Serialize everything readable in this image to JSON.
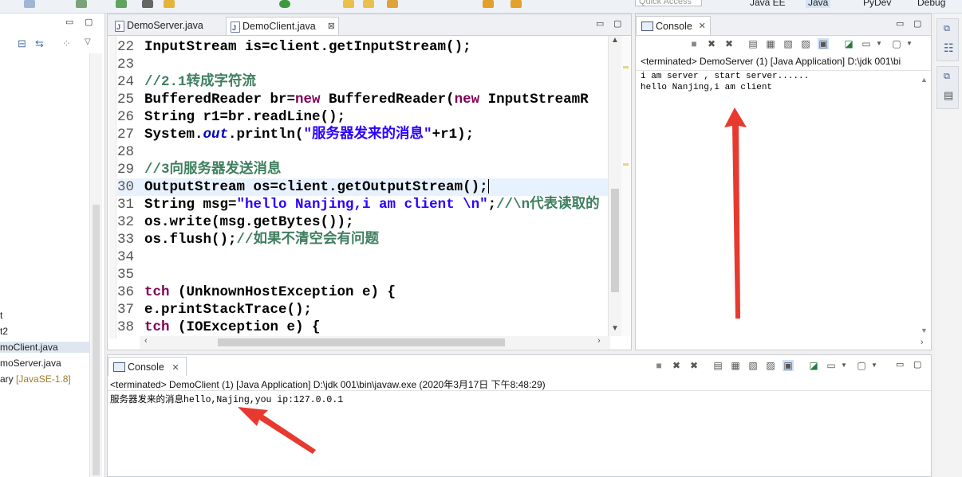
{
  "toolbar": {
    "quick_access_placeholder": "Quick Access",
    "perspectives": [
      "Java EE",
      "Java",
      "PyDev",
      "Debug"
    ]
  },
  "explorer": {
    "items": [
      {
        "label": "t",
        "selected": false
      },
      {
        "label": "t2",
        "selected": false
      },
      {
        "label": "moClient.java",
        "selected": true
      },
      {
        "label": "moServer.java",
        "selected": false
      },
      {
        "label": "ary",
        "lib": "[JavaSE-1.8]",
        "selected": false
      }
    ]
  },
  "editor": {
    "tabs": [
      {
        "label": "DemoServer.java",
        "active": false
      },
      {
        "label": "DemoClient.java",
        "active": true,
        "close": "⊠"
      }
    ],
    "lines": [
      {
        "n": "22",
        "segs": [
          {
            "t": "InputStream is=client.getInputStream();",
            "c": ""
          }
        ]
      },
      {
        "n": "23",
        "segs": []
      },
      {
        "n": "24",
        "segs": [
          {
            "t": "//2.1转成字符流",
            "c": "cm"
          }
        ]
      },
      {
        "n": "25",
        "segs": [
          {
            "t": "BufferedReader br=",
            "c": ""
          },
          {
            "t": "new",
            "c": "kw"
          },
          {
            "t": " BufferedReader(",
            "c": ""
          },
          {
            "t": "new",
            "c": "kw"
          },
          {
            "t": " InputStreamR",
            "c": ""
          }
        ]
      },
      {
        "n": "26",
        "segs": [
          {
            "t": "String r1=br.readLine();",
            "c": ""
          }
        ]
      },
      {
        "n": "27",
        "segs": [
          {
            "t": "System.",
            "c": ""
          },
          {
            "t": "out",
            "c": "fd"
          },
          {
            "t": ".println(",
            "c": ""
          },
          {
            "t": "\"服务器发来的消息\"",
            "c": "st"
          },
          {
            "t": "+r1);",
            "c": ""
          }
        ]
      },
      {
        "n": "28",
        "segs": []
      },
      {
        "n": "29",
        "segs": [
          {
            "t": "//3向服务器发送消息",
            "c": "cm"
          }
        ]
      },
      {
        "n": "30",
        "segs": [
          {
            "t": "OutputStream os=client.getOutputStream();",
            "c": ""
          }
        ],
        "current": true
      },
      {
        "n": "31",
        "segs": [
          {
            "t": "String msg=",
            "c": ""
          },
          {
            "t": "\"hello Nanjing,i am client \\n\"",
            "c": "st"
          },
          {
            "t": ";",
            "c": ""
          },
          {
            "t": "//\\n代表读取的",
            "c": "cm"
          }
        ]
      },
      {
        "n": "32",
        "segs": [
          {
            "t": "os.write(msg.getBytes());",
            "c": ""
          }
        ]
      },
      {
        "n": "33",
        "segs": [
          {
            "t": "os.flush();",
            "c": ""
          },
          {
            "t": "//如果不清空会有问题",
            "c": "cm"
          }
        ]
      },
      {
        "n": "34",
        "segs": []
      },
      {
        "n": "35",
        "segs": []
      },
      {
        "n": "36",
        "segs": [
          {
            "t": "tch",
            "c": "kw"
          },
          {
            "t": " (UnknownHostException e) {",
            "c": ""
          }
        ]
      },
      {
        "n": "37",
        "segs": [
          {
            "t": "e.printStackTrace();",
            "c": ""
          }
        ]
      },
      {
        "n": "38",
        "segs": [
          {
            "t": "tch",
            "c": "kw"
          },
          {
            "t": " (IOException e) {",
            "c": ""
          }
        ]
      }
    ]
  },
  "right_console": {
    "tab_label": "Console",
    "terminated": "<terminated> DemoServer (1) [Java Application] D:\\jdk  001\\bi",
    "output": [
      "i am server , start server......",
      "hello Nanjing,i am client"
    ]
  },
  "bottom_console": {
    "tab_label": "Console",
    "terminated": "<terminated> DemoClient (1) [Java Application] D:\\jdk  001\\bin\\javaw.exe (2020年3月17日 下午8:48:29)",
    "output": [
      "服务器发来的消息hello,Najing,you ip:127.0.0.1"
    ]
  },
  "colors": {
    "keyword": "#7f0055",
    "string": "#2a00ff",
    "comment": "#3f7f5f",
    "field": "#0000c0",
    "annotation_arrow": "#e8392f"
  }
}
